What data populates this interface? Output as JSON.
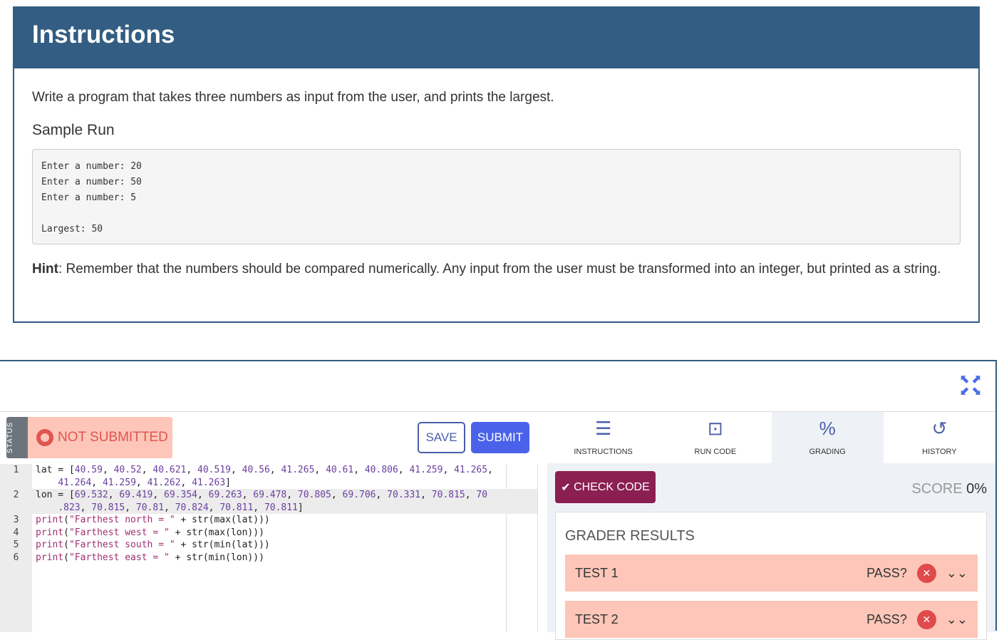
{
  "instructions": {
    "title": "Instructions",
    "description": "Write a program that takes three numbers as input from the user, and prints the largest.",
    "sample_run_heading": "Sample Run",
    "sample_run": "Enter a number: 20\nEnter a number: 50\nEnter a number: 5\n\nLargest: 50",
    "hint_label": "Hint",
    "hint_text": ": Remember that the numbers should be compared numerically.  Any input from the user must be transformed into an integer, but printed as a string."
  },
  "status": {
    "tag": "STATUS",
    "text": "NOT SUBMITTED"
  },
  "buttons": {
    "save": "SAVE",
    "submit": "SUBMIT",
    "check_code": "CHECK CODE"
  },
  "editor": {
    "line_numbers": [
      "1",
      "2",
      "3",
      "4",
      "5",
      "6"
    ]
  },
  "tabs": [
    {
      "label": "INSTRUCTIONS"
    },
    {
      "label": "RUN CODE"
    },
    {
      "label": "GRADING"
    },
    {
      "label": "HISTORY"
    }
  ],
  "score": {
    "label": "SCORE",
    "value": "0%"
  },
  "grader": {
    "title": "GRADER RESULTS",
    "tests": [
      {
        "name": "TEST 1",
        "pass_label": "PASS?"
      },
      {
        "name": "TEST 2",
        "pass_label": "PASS?"
      }
    ]
  }
}
